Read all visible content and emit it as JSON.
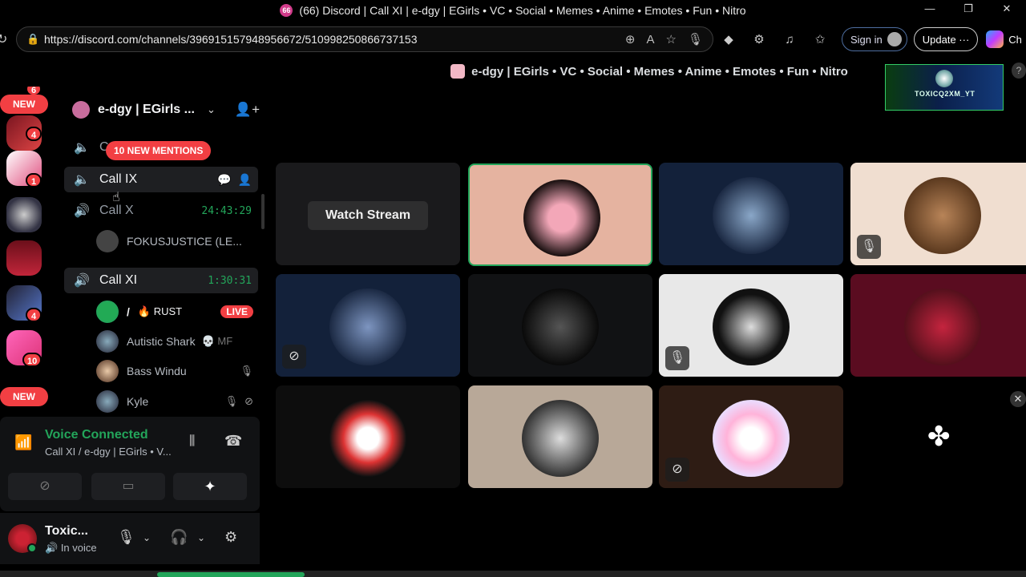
{
  "browser": {
    "tab_badge": "66",
    "title": "(66) Discord | Call XI | e-dgy | EGirls • VC • Social • Memes • Anime • Emotes • Fun • Nitro",
    "url": "https://discord.com/channels/396915157948956672/510998250866737153",
    "sign_in": "Sign in",
    "update": "Update",
    "copilot_partial": "Ch"
  },
  "server_header": "e-dgy | EGirls • VC • Social • Memes • Anime • Emotes • Fun • Nitro",
  "stream_preview_label": "TOXICQ2XM_YT",
  "rail": {
    "badges": [
      "6",
      "4",
      "1",
      "4",
      "10"
    ],
    "new_label": "NEW"
  },
  "guild": {
    "name": "e-dgy | EGirls ..."
  },
  "mentions_pill": "10 NEW MENTIONS",
  "channels": [
    {
      "name": "C",
      "time": ""
    },
    {
      "name": "Call IX",
      "time": ""
    },
    {
      "name": "Call X",
      "time": "24:43:29"
    },
    {
      "name": "Call XI",
      "time": "1:30:31"
    }
  ],
  "users_call_x": [
    {
      "name": "FOKUSJUSTICE (LE..."
    }
  ],
  "users_call_xi": [
    {
      "name": "/",
      "activity": "🔥 RUST",
      "badge": "LIVE"
    },
    {
      "name": "Autistic Shark",
      "extra": "💀 MF"
    },
    {
      "name": "Bass Windu"
    },
    {
      "name": "Kyle"
    }
  ],
  "voice": {
    "title": "Voice Connected",
    "subtitle": "Call XI / e-dgy | EGirls • V..."
  },
  "user": {
    "name": "Toxic...",
    "status": "In voice"
  },
  "watch_stream": "Watch Stream",
  "colors": {
    "green": "#23a55a",
    "red": "#f23f43",
    "tile_dark": "#111214"
  }
}
